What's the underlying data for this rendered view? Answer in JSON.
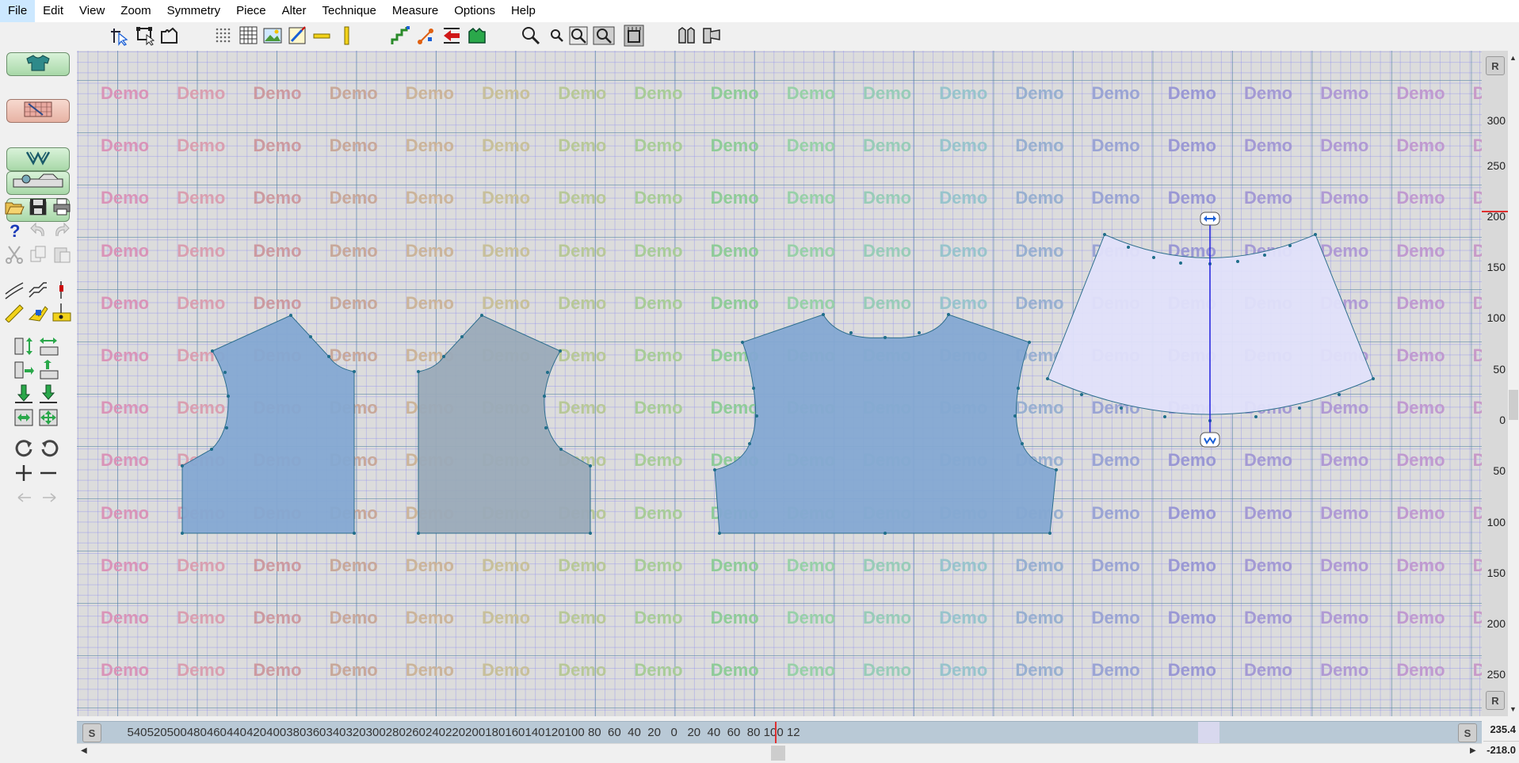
{
  "menu": [
    "File",
    "Edit",
    "View",
    "Zoom",
    "Symmetry",
    "Piece",
    "Alter",
    "Technique",
    "Measure",
    "Options",
    "Help"
  ],
  "watermark_text": "Demo",
  "watermark_colors": [
    "#d994b8",
    "#d99fb0",
    "#cc9aa0",
    "#c8a89a",
    "#cbb49a",
    "#c8c09a",
    "#b8c898",
    "#a8cc98",
    "#8fcc98",
    "#98d0a8",
    "#98ccb8",
    "#98c4cc",
    "#98b0d0",
    "#9aa4d4",
    "#9a98d4",
    "#a49ad4",
    "#b09ad4",
    "#c09ad0",
    "#c89ac8"
  ],
  "vertical_ruler": [
    "300",
    "250",
    "200",
    "150",
    "100",
    "50",
    "0",
    "50",
    "100",
    "150",
    "200",
    "250"
  ],
  "horizontal_ruler": [
    "540",
    "520",
    "500",
    "480",
    "460",
    "440",
    "420",
    "400",
    "380",
    "360",
    "340",
    "320",
    "300",
    "280",
    "260",
    "240",
    "220",
    "200",
    "180",
    "160",
    "140",
    "120",
    "100",
    "80",
    "60",
    "40",
    "20",
    "0",
    "20",
    "40",
    "60",
    "80",
    "100",
    "12"
  ],
  "ruler_corner_label": "R",
  "scale_label": "S",
  "coords": {
    "x": "235.4",
    "y": "-218.0"
  },
  "colors": {
    "piece_blue": "#84a8d2",
    "piece_grey": "#9aaab8",
    "piece_lavender": "#e0e0fa",
    "grid_major": "#5082a0",
    "grid_minor": "#8282f0"
  }
}
